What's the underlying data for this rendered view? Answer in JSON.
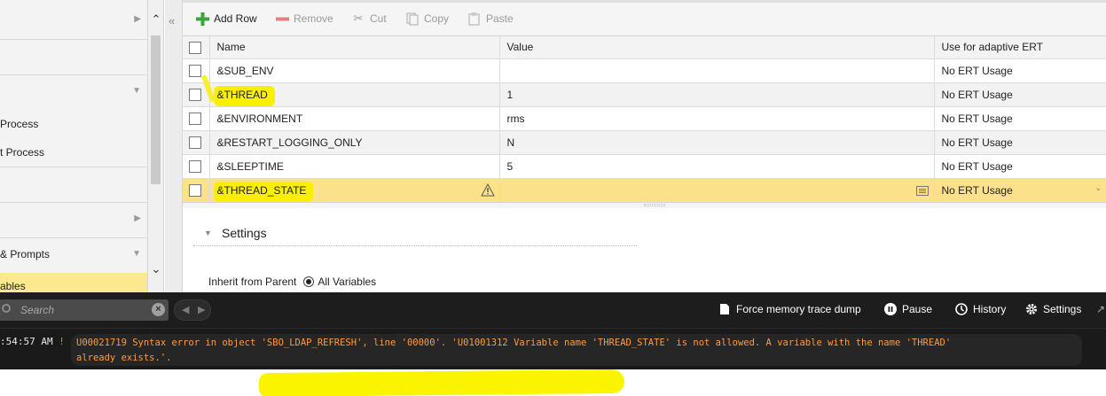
{
  "sidebar": {
    "items": [
      {
        "label": "",
        "has_arrow": true
      },
      {
        "label": "Process"
      },
      {
        "label": "t Process"
      },
      {
        "label": "& Prompts"
      },
      {
        "label": "ables"
      }
    ]
  },
  "toolbar": {
    "add_row": "Add Row",
    "remove": "Remove",
    "cut": "Cut",
    "copy": "Copy",
    "paste": "Paste"
  },
  "grid": {
    "columns": [
      "Name",
      "Value",
      "Use for adaptive ERT"
    ],
    "rows": [
      {
        "name": "&SUB_ENV",
        "value": "",
        "ert": "No ERT Usage"
      },
      {
        "name": "&THREAD",
        "value": "1",
        "ert": "No ERT Usage"
      },
      {
        "name": "&ENVIRONMENT",
        "value": "rms",
        "ert": "No ERT Usage"
      },
      {
        "name": "&RESTART_LOGGING_ONLY",
        "value": "N",
        "ert": "No ERT Usage"
      },
      {
        "name": "&SLEEPTIME",
        "value": "5",
        "ert": "No ERT Usage"
      },
      {
        "name": "&THREAD_STATE",
        "value": "",
        "ert": "No ERT Usage"
      }
    ]
  },
  "settings": {
    "title": "Settings",
    "inherit_label": "Inherit from Parent",
    "radio_label": "All Variables"
  },
  "console": {
    "search_placeholder": "Search",
    "force_dump": "Force memory trace dump",
    "pause": "Pause",
    "history": "History",
    "settings": "Settings",
    "log_time": ":54:57 AM",
    "log_flag": "!",
    "log_line1": "U00021719 Syntax error in object 'SBO_LDAP_REFRESH', line '00000'. 'U01001312 Variable name 'THREAD_STATE' is not allowed. A variable with the name 'THREAD'",
    "log_line2": "already exists.'."
  },
  "colors": {
    "selected_row": "#fbe28a",
    "highlight": "#f8f000",
    "log_text": "#ff9b3d",
    "console_bg": "#1d1d1d"
  }
}
